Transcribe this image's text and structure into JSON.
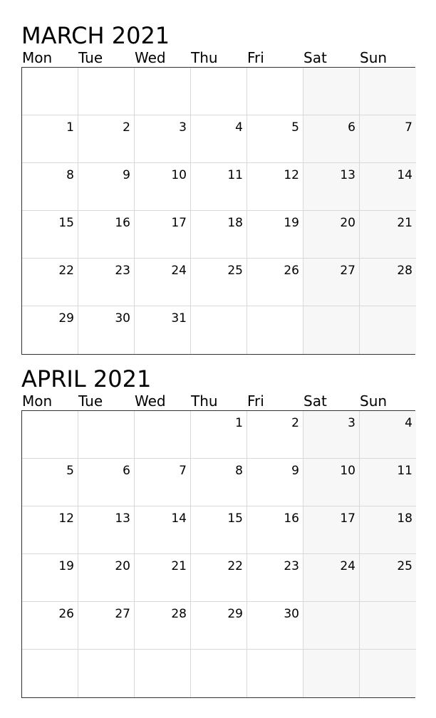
{
  "weekdays": [
    "Mon",
    "Tue",
    "Wed",
    "Thu",
    "Fri",
    "Sat",
    "Sun"
  ],
  "months": [
    {
      "title": "MARCH 2021",
      "cells": [
        "",
        "",
        "",
        "",
        "",
        "",
        "",
        "1",
        "2",
        "3",
        "4",
        "5",
        "6",
        "7",
        "8",
        "9",
        "10",
        "11",
        "12",
        "13",
        "14",
        "15",
        "16",
        "17",
        "18",
        "19",
        "20",
        "21",
        "22",
        "23",
        "24",
        "25",
        "26",
        "27",
        "28",
        "29",
        "30",
        "31",
        "",
        "",
        "",
        ""
      ]
    },
    {
      "title": "APRIL 2021",
      "cells": [
        "",
        "",
        "",
        "1",
        "2",
        "3",
        "4",
        "5",
        "6",
        "7",
        "8",
        "9",
        "10",
        "11",
        "12",
        "13",
        "14",
        "15",
        "16",
        "17",
        "18",
        "19",
        "20",
        "21",
        "22",
        "23",
        "24",
        "25",
        "26",
        "27",
        "28",
        "29",
        "30",
        "",
        "",
        "",
        "",
        "",
        "",
        "",
        "",
        ""
      ]
    }
  ],
  "colors": {
    "weekend_shade": "#f7f7f7",
    "grid_line": "#d8d8d8",
    "border": "#333333"
  }
}
